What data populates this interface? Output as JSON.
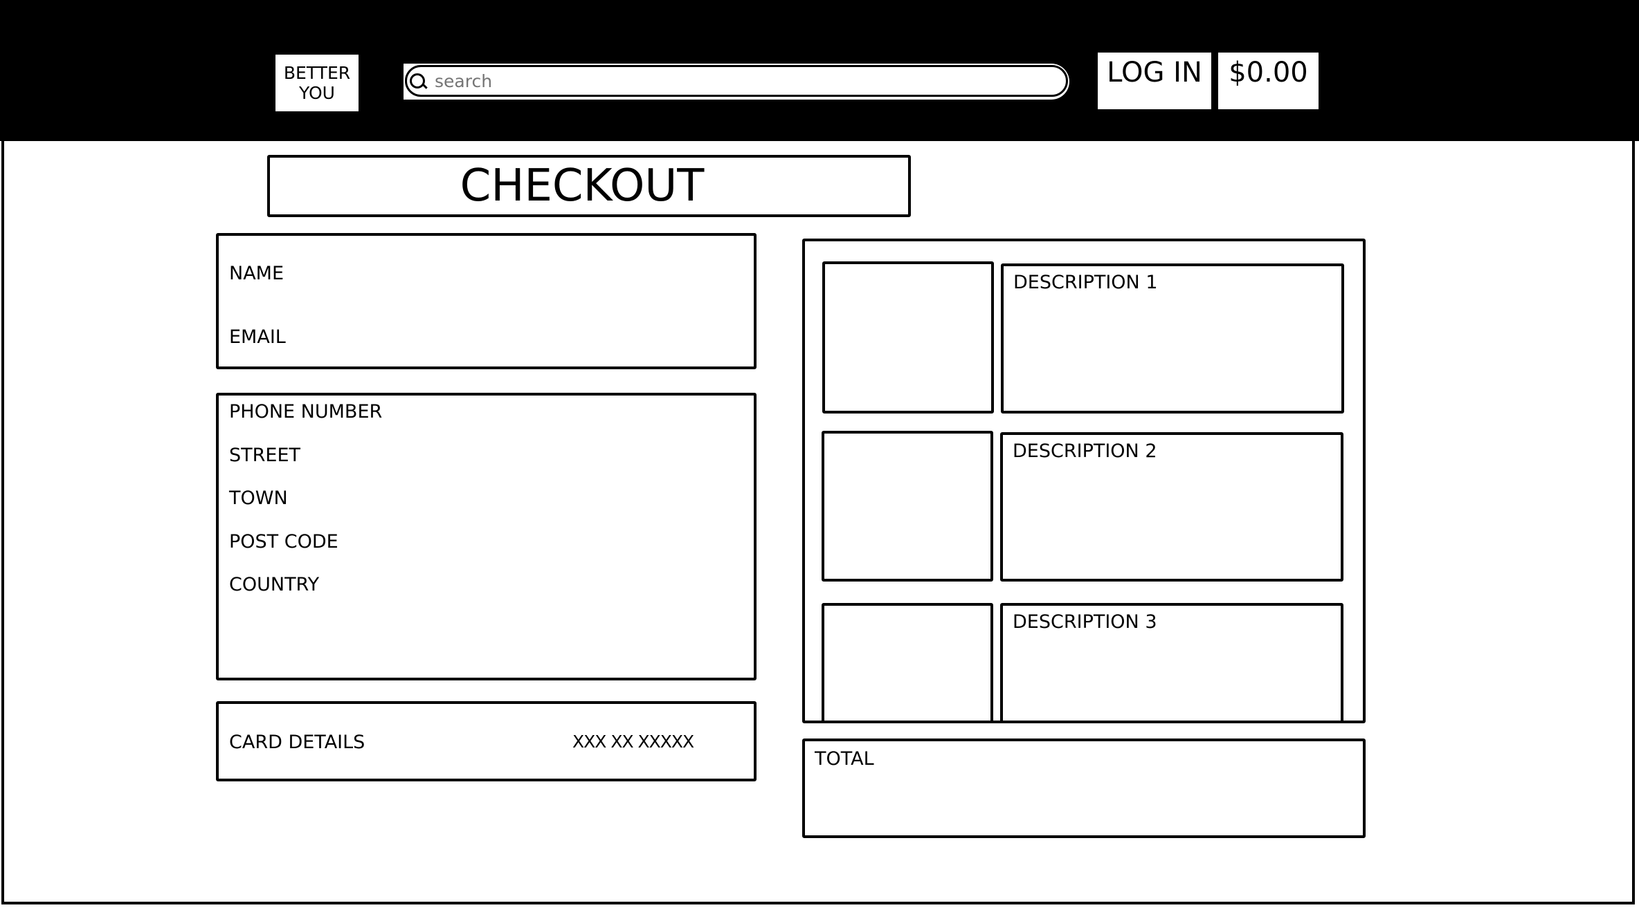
{
  "header": {
    "logo": "BETTER\nYOU",
    "logo_line1": "BETTER",
    "logo_line2": "YOU",
    "search_placeholder": "search",
    "login_label": "LOG IN",
    "cart_total": "$0.00"
  },
  "page_title": "CHECKOUT",
  "form": {
    "name_label": "NAME",
    "email_label": "EMAIL",
    "address_fields": [
      "PHONE NUMBER",
      "STREET",
      "TOWN",
      "POST CODE",
      "COUNTRY"
    ],
    "card_label": "CARD DETAILS",
    "card_number": "XXX XX XXXXX"
  },
  "cart": {
    "items": [
      {
        "description": "DESCRIPTION 1"
      },
      {
        "description": "DESCRIPTION 2"
      },
      {
        "description": "DESCRIPTION 3"
      }
    ],
    "total_label": "TOTAL"
  }
}
